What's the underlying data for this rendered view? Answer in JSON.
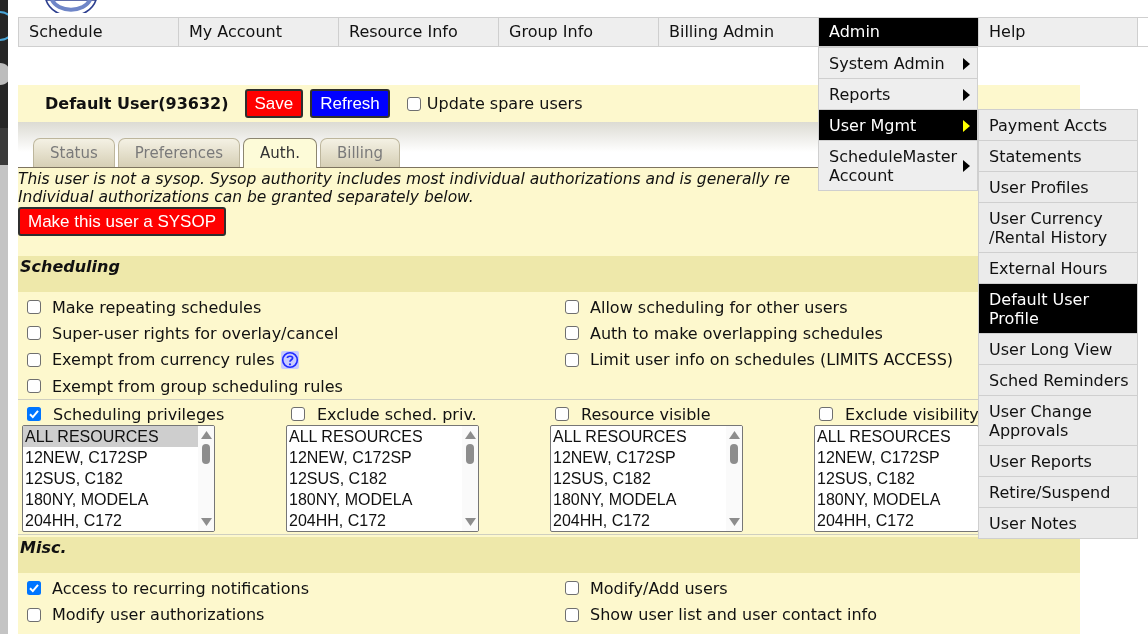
{
  "navigation": {
    "items": [
      {
        "label": "Schedule",
        "selected": false
      },
      {
        "label": "My Account",
        "selected": false
      },
      {
        "label": "Resource Info",
        "selected": false
      },
      {
        "label": "Group Info",
        "selected": false
      },
      {
        "label": "Billing Admin",
        "selected": false
      },
      {
        "label": "Admin",
        "selected": true,
        "menu": [
          {
            "label": "System Admin",
            "selected": false,
            "submenu_arrow": true
          },
          {
            "label": "Reports",
            "selected": false,
            "submenu_arrow": true
          },
          {
            "label": "User Mgmt",
            "selected": true,
            "submenu_arrow": true,
            "submenu": [
              {
                "label": "Payment Accts",
                "selected": false
              },
              {
                "label": "Statements",
                "selected": false
              },
              {
                "label": "User Profiles",
                "selected": false
              },
              {
                "label": "User Currency /Rental History",
                "selected": false
              },
              {
                "label": "External Hours",
                "selected": false
              },
              {
                "label": "Default User Profile",
                "selected": true
              },
              {
                "label": "User Long View",
                "selected": false
              },
              {
                "label": "Sched Reminders",
                "selected": false
              },
              {
                "label": "User Change Approvals",
                "selected": false
              },
              {
                "label": "User Reports",
                "selected": false
              },
              {
                "label": "Retire/Suspend",
                "selected": false
              },
              {
                "label": "User Notes",
                "selected": false
              }
            ]
          },
          {
            "label": "ScheduleMaster Account",
            "selected": false,
            "submenu_arrow": true
          }
        ]
      },
      {
        "label": "Help",
        "selected": false
      }
    ]
  },
  "user_header": {
    "title": "Default User(93632)",
    "buttons": [
      {
        "label": "Save",
        "kind": "save"
      },
      {
        "label": "Refresh",
        "kind": "refresh"
      }
    ],
    "update_spare_users": {
      "label": "Update spare users",
      "checked": false
    }
  },
  "tabs": [
    {
      "label": "Status",
      "selected": false
    },
    {
      "label": "Preferences",
      "selected": false
    },
    {
      "label": "Auth.",
      "selected": true
    },
    {
      "label": "Billing",
      "selected": false
    }
  ],
  "notice_lines": [
    "This user is not a sysop. Sysop authority includes most individual authorizations and is generally re",
    "Individual authorizations can be granted separately below."
  ],
  "sysop_button": "Make this user a SYSOP",
  "sections": [
    {
      "title": "Scheduling",
      "left": [
        {
          "label": "Make repeating schedules",
          "checked": false
        },
        {
          "label": "Super-user rights for overlay/cancel",
          "checked": false
        },
        {
          "label": "Exempt from currency rules",
          "checked": false,
          "help": true
        },
        {
          "label": "Exempt from group scheduling rules",
          "checked": false
        }
      ],
      "right": [
        {
          "label": "Allow scheduling for other users",
          "checked": false
        },
        {
          "label": "Auth to make overlapping schedules",
          "checked": false
        },
        {
          "label": "Limit user info on schedules (LIMITS ACCESS)",
          "checked": false
        }
      ],
      "resource_lists": [
        {
          "label": "Scheduling privileges",
          "checked": true,
          "scrollbar": true,
          "items": [
            {
              "label": "ALL RESOURCES",
              "selected": true
            },
            {
              "label": "12NEW, C172SP",
              "selected": false
            },
            {
              "label": "12SUS, C182",
              "selected": false
            },
            {
              "label": "180NY, MODELA",
              "selected": false
            },
            {
              "label": "204HH, C172",
              "selected": false
            }
          ]
        },
        {
          "label": "Exclude sched. priv.",
          "checked": false,
          "scrollbar": true,
          "items": [
            {
              "label": "ALL RESOURCES",
              "selected": false
            },
            {
              "label": "12NEW, C172SP",
              "selected": false
            },
            {
              "label": "12SUS, C182",
              "selected": false
            },
            {
              "label": "180NY, MODELA",
              "selected": false
            },
            {
              "label": "204HH, C172",
              "selected": false
            }
          ]
        },
        {
          "label": "Resource visible",
          "checked": false,
          "scrollbar": true,
          "items": [
            {
              "label": "ALL RESOURCES",
              "selected": false
            },
            {
              "label": "12NEW, C172SP",
              "selected": false
            },
            {
              "label": "12SUS, C182",
              "selected": false
            },
            {
              "label": "180NY, MODELA",
              "selected": false
            },
            {
              "label": "204HH, C172",
              "selected": false
            }
          ]
        },
        {
          "label": "Exclude visibility",
          "checked": false,
          "scrollbar": false,
          "items": [
            {
              "label": "ALL RESOURCES",
              "selected": false
            },
            {
              "label": "12NEW, C172SP",
              "selected": false
            },
            {
              "label": "12SUS, C182",
              "selected": false
            },
            {
              "label": "180NY, MODELA",
              "selected": false
            },
            {
              "label": "204HH, C172",
              "selected": false
            }
          ]
        }
      ]
    },
    {
      "title": "Misc.",
      "left": [
        {
          "label": "Access to recurring notifications",
          "checked": true
        },
        {
          "label": "Modify user authorizations",
          "checked": false
        }
      ],
      "right": [
        {
          "label": "Modify/Add users",
          "checked": false
        },
        {
          "label": "Show user list and user contact info",
          "checked": false
        }
      ]
    }
  ]
}
